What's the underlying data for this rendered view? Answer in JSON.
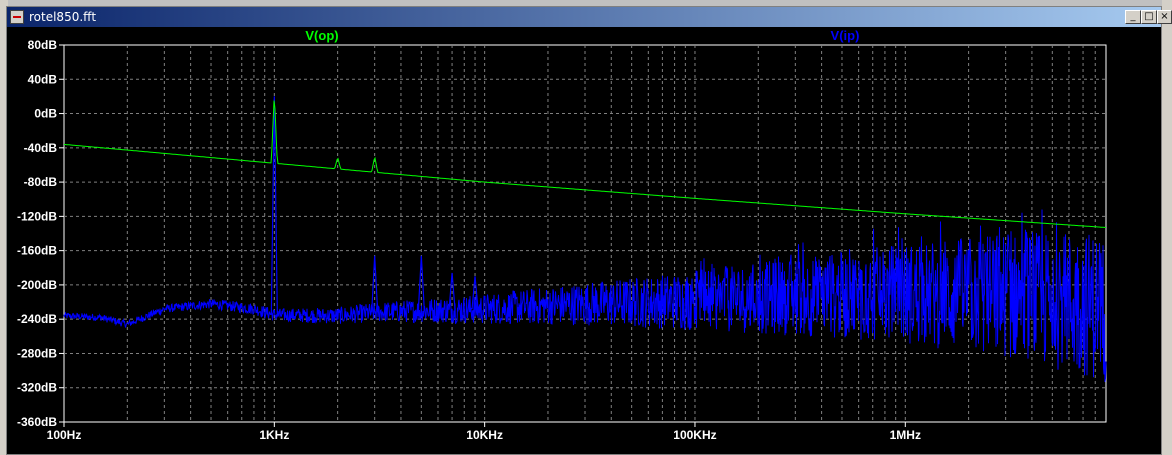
{
  "window": {
    "title": "rotel850.fft",
    "buttons": {
      "minimize": "_",
      "maximize": "□",
      "close": "×"
    }
  },
  "chart_data": {
    "type": "line",
    "x_scale": "log",
    "xlim_hz": [
      100,
      9000000
    ],
    "ylim_db": [
      -360,
      80
    ],
    "grid": true,
    "y_ticks": [
      "80dB",
      "40dB",
      "0dB",
      "-40dB",
      "-80dB",
      "-120dB",
      "-160dB",
      "-200dB",
      "-240dB",
      "-280dB",
      "-320dB",
      "-360dB"
    ],
    "y_tick_values": [
      80,
      40,
      0,
      -40,
      -80,
      -120,
      -160,
      -200,
      -240,
      -280,
      -320,
      -360
    ],
    "x_ticks": [
      "100Hz",
      "1KHz",
      "10KHz",
      "100KHz",
      "1MHz"
    ],
    "x_tick_values": [
      100,
      1000,
      10000,
      100000,
      1000000
    ],
    "colors": {
      "background": "#000000",
      "grid": "#808080",
      "axis_text": "#ffffff"
    },
    "series": [
      {
        "name": "V(op)",
        "color": "#00ff00",
        "baseline_points": [
          [
            100,
            -36
          ],
          [
            1000,
            -58
          ],
          [
            10000,
            -80
          ],
          [
            100000,
            -99
          ],
          [
            1000000,
            -117
          ],
          [
            9000000,
            -133
          ]
        ],
        "peaks": [
          {
            "hz": 1000,
            "db": 24
          },
          {
            "hz": 2000,
            "db": -51
          },
          {
            "hz": 3000,
            "db": -50
          }
        ]
      },
      {
        "name": "V(ip)",
        "color": "#0000ff",
        "noise_floor_points": [
          [
            100,
            -236
          ],
          [
            150,
            -238
          ],
          [
            200,
            -246
          ],
          [
            300,
            -228
          ],
          [
            500,
            -222
          ],
          [
            800,
            -228
          ],
          [
            1000,
            -235
          ],
          [
            2000,
            -236
          ],
          [
            3000,
            -232
          ],
          [
            5000,
            -230
          ],
          [
            10000,
            -228
          ],
          [
            30000,
            -222
          ],
          [
            100000,
            -218
          ],
          [
            300000,
            -214
          ],
          [
            1000000,
            -210
          ],
          [
            3000000,
            -212
          ],
          [
            9000000,
            -225
          ]
        ],
        "peaks": [
          {
            "hz": 1000,
            "db": 20
          },
          {
            "hz": 3000,
            "db": -166
          },
          {
            "hz": 5000,
            "db": -166
          },
          {
            "hz": 7000,
            "db": -186
          },
          {
            "hz": 9000,
            "db": -190
          }
        ]
      }
    ]
  }
}
